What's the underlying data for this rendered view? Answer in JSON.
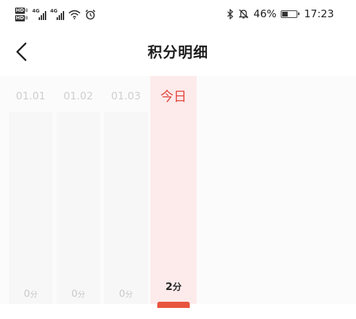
{
  "status_bar": {
    "left_tags": [
      "HD",
      "HD"
    ],
    "network_labels": [
      "4G",
      "4G"
    ],
    "battery_text": "46%",
    "battery_level": 0.46,
    "time": "17:23",
    "icons": [
      "hd-icon",
      "signal-icon",
      "wifi-icon",
      "alarm-icon",
      "bluetooth-icon",
      "mute-icon",
      "battery-icon"
    ]
  },
  "header": {
    "title": "积分明细",
    "back_icon": "chevron-left-icon"
  },
  "chart_data": {
    "type": "bar",
    "categories": [
      "01.01",
      "01.02",
      "01.03",
      "今日"
    ],
    "values": [
      0,
      0,
      0,
      2
    ],
    "unit": "分",
    "highlight_index": 3,
    "accent_color": "#e0443b",
    "bar_color": "#e8553e",
    "highlight_bg": "#fdeaea"
  }
}
